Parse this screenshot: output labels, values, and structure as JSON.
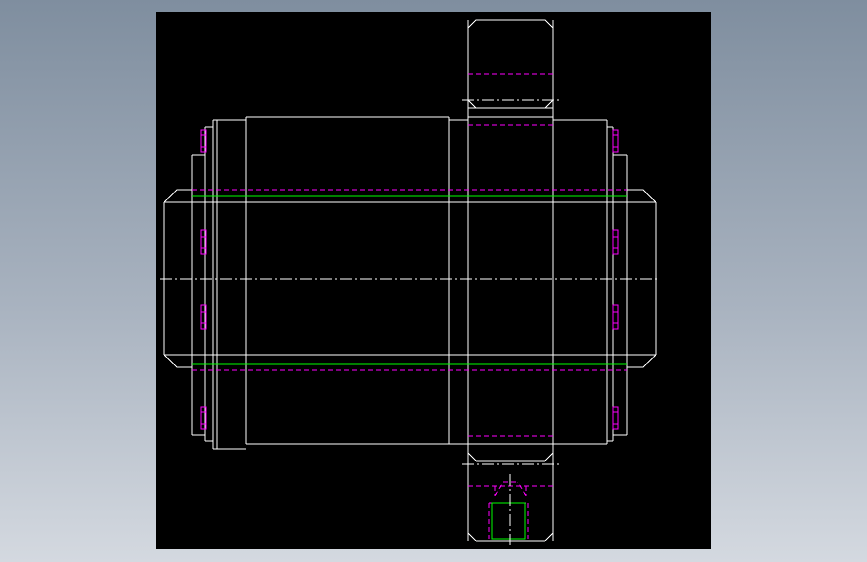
{
  "viewport": {
    "background": "#000000"
  },
  "colors": {
    "outline": "#ffffff",
    "hidden": "#ff00ff",
    "thread": "#00ff00",
    "centerline": "#ffffff"
  },
  "drawing": {
    "type": "cad-orthographic-view",
    "subject": "gear-shaft-assembly",
    "has_text_labels": false
  }
}
